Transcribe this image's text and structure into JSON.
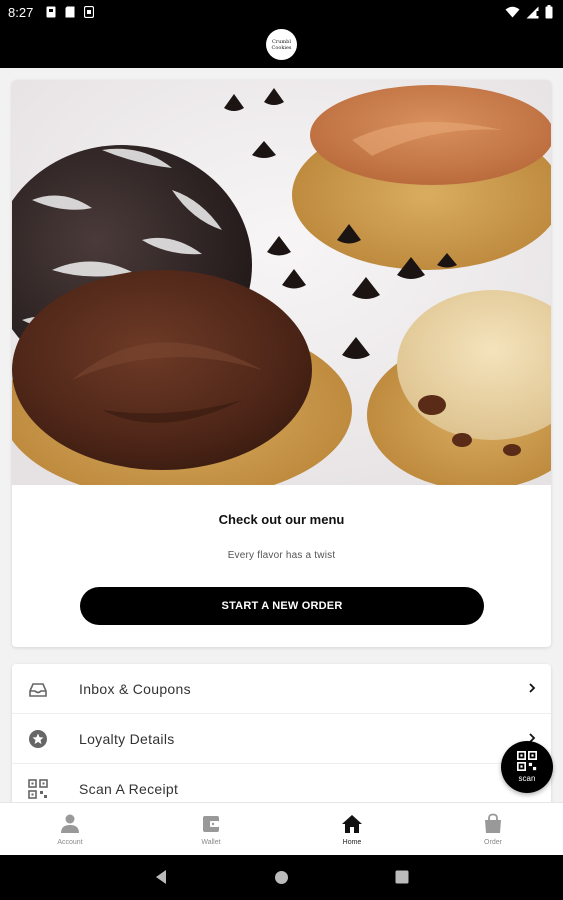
{
  "status_bar": {
    "time": "8:27",
    "left_icons": [
      "notification-icon",
      "card-icon",
      "sim-icon"
    ],
    "right_icons": [
      "wifi-icon",
      "signal-icon",
      "battery-icon"
    ]
  },
  "header": {
    "logo_text": "Crumbl Cookies",
    "logo_icon": "brand-logo-icon"
  },
  "menu_card": {
    "title": "Check out our menu",
    "subtitle": "Every flavor has a twist",
    "button_label": "START A NEW ORDER"
  },
  "list_items": [
    {
      "label": "Inbox & Coupons",
      "icon": "inbox-icon"
    },
    {
      "label": "Loyalty Details",
      "icon": "star-badge-icon"
    },
    {
      "label": "Scan A Receipt",
      "icon": "qr-code-icon"
    }
  ],
  "scan_fab": {
    "label": "scan",
    "icon": "qr-code-icon"
  },
  "bottom_nav": [
    {
      "label": "Account",
      "icon": "person-icon",
      "active": false
    },
    {
      "label": "Wallet",
      "icon": "wallet-icon",
      "active": false
    },
    {
      "label": "Home",
      "icon": "home-icon",
      "active": true
    },
    {
      "label": "Order",
      "icon": "shopping-bag-icon",
      "active": false
    }
  ],
  "android_nav": [
    "back-icon",
    "home-circle-icon",
    "recents-icon"
  ],
  "colors": {
    "primary": "#000000",
    "background": "#f2f2f2",
    "card": "#ffffff"
  }
}
